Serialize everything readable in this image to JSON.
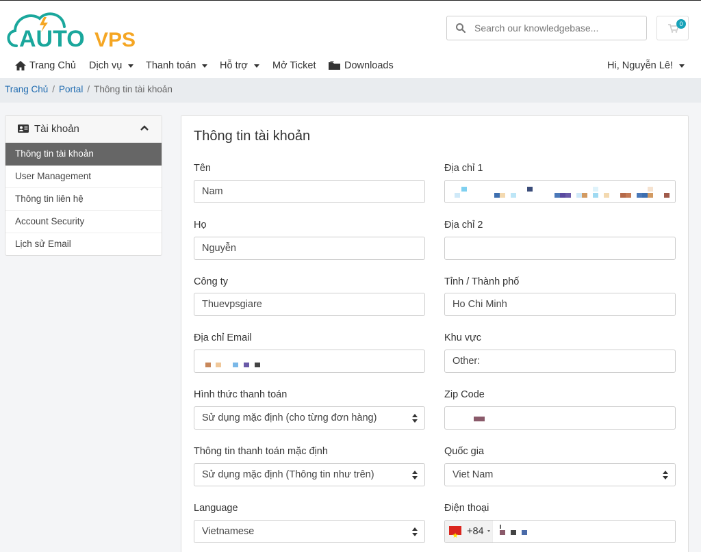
{
  "brand": {
    "logo_text_a": "AUTO",
    "logo_text_b": "VPS",
    "color_teal": "#1aa79c",
    "color_orange": "#f5a623"
  },
  "search": {
    "placeholder": "Search our knowledgebase..."
  },
  "cart": {
    "count": "0"
  },
  "nav": {
    "items": [
      {
        "label": "Trang Chủ",
        "icon": "home-icon"
      },
      {
        "label": "Dịch vụ",
        "dropdown": true
      },
      {
        "label": "Thanh toán",
        "dropdown": true
      },
      {
        "label": "Hỗ trợ",
        "dropdown": true
      },
      {
        "label": "Mở Ticket"
      },
      {
        "label": "Downloads",
        "icon": "folder-icon"
      }
    ],
    "user": "Hi, Nguyễn Lê!"
  },
  "breadcrumb": {
    "home": "Trang Chủ",
    "portal": "Portal",
    "current": "Thông tin tài khoản"
  },
  "sidebar": {
    "title": "Tài khoản",
    "items": [
      {
        "label": "Thông tin tài khoản",
        "active": true
      },
      {
        "label": "User Management"
      },
      {
        "label": "Thông tin liên hệ"
      },
      {
        "label": "Account Security"
      },
      {
        "label": "Lịch sử Email"
      }
    ]
  },
  "form": {
    "title": "Thông tin tài khoản",
    "first_name": {
      "label": "Tên",
      "value": "Nam"
    },
    "last_name": {
      "label": "Họ",
      "value": "Nguyễn"
    },
    "company": {
      "label": "Công ty",
      "value": "Thuevpsgiare"
    },
    "email": {
      "label": "Địa chỉ Email",
      "value": ""
    },
    "payment_method": {
      "label": "Hình thức thanh toán",
      "value": "Sử dụng mặc định (cho từng đơn hàng)"
    },
    "billing_contact": {
      "label": "Thông tin thanh toán mặc định",
      "value": "Sử dụng mặc định (Thông tin như trên)"
    },
    "language": {
      "label": "Language",
      "value": "Vietnamese"
    },
    "address1": {
      "label": "Địa chỉ 1",
      "value": ""
    },
    "address2": {
      "label": "Địa chỉ 2",
      "value": ""
    },
    "city": {
      "label": "Tỉnh / Thành phố",
      "value": "Ho Chi Minh"
    },
    "region": {
      "label": "Khu vực",
      "value": "Other:"
    },
    "zip": {
      "label": "Zip Code",
      "value": ""
    },
    "country": {
      "label": "Quốc gia",
      "value": "Viet Nam"
    },
    "phone": {
      "label": "Điện thoại",
      "code": "+84",
      "value": ""
    }
  }
}
